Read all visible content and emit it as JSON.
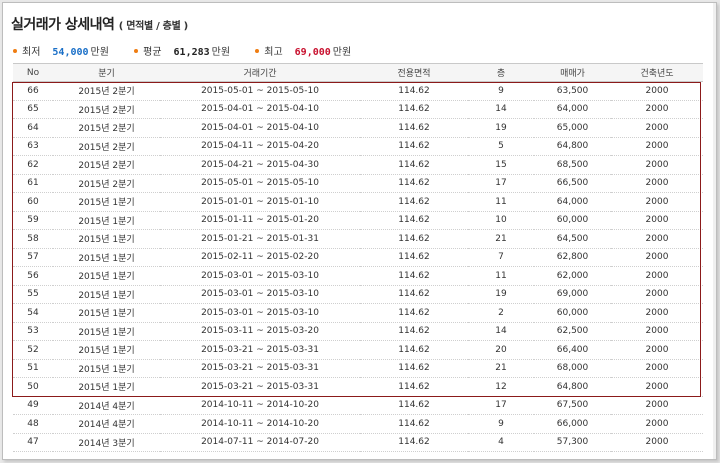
{
  "title": {
    "main": "실거래가 상세내역",
    "sub": "( 면적별 / 층별 )"
  },
  "summary": [
    {
      "label": "최저",
      "value": "54,000",
      "unit": "만원",
      "color": "#1a6fc7"
    },
    {
      "label": "평균",
      "value": "61,283",
      "unit": "만원",
      "color": "#222222"
    },
    {
      "label": "최고",
      "value": "69,000",
      "unit": "만원",
      "color": "#c8102e"
    }
  ],
  "colors": {
    "bullet": "#ef7d12",
    "highlight_border": "#8b1a1a",
    "min": "#1a6fc7",
    "max": "#c8102e"
  },
  "table": {
    "headers": [
      "No",
      "분기",
      "거래기간",
      "전용면적",
      "층",
      "매매가",
      "건축년도"
    ],
    "rows": [
      [
        "66",
        "2015년 2분기",
        "2015-05-01 ~ 2015-05-10",
        "114.62",
        "9",
        "63,500",
        "2000"
      ],
      [
        "65",
        "2015년 2분기",
        "2015-04-01 ~ 2015-04-10",
        "114.62",
        "14",
        "64,000",
        "2000"
      ],
      [
        "64",
        "2015년 2분기",
        "2015-04-01 ~ 2015-04-10",
        "114.62",
        "19",
        "65,000",
        "2000"
      ],
      [
        "63",
        "2015년 2분기",
        "2015-04-11 ~ 2015-04-20",
        "114.62",
        "5",
        "64,800",
        "2000"
      ],
      [
        "62",
        "2015년 2분기",
        "2015-04-21 ~ 2015-04-30",
        "114.62",
        "15",
        "68,500",
        "2000"
      ],
      [
        "61",
        "2015년 2분기",
        "2015-05-01 ~ 2015-05-10",
        "114.62",
        "17",
        "66,500",
        "2000"
      ],
      [
        "60",
        "2015년 1분기",
        "2015-01-01 ~ 2015-01-10",
        "114.62",
        "11",
        "64,000",
        "2000"
      ],
      [
        "59",
        "2015년 1분기",
        "2015-01-11 ~ 2015-01-20",
        "114.62",
        "10",
        "60,000",
        "2000"
      ],
      [
        "58",
        "2015년 1분기",
        "2015-01-21 ~ 2015-01-31",
        "114.62",
        "21",
        "64,500",
        "2000"
      ],
      [
        "57",
        "2015년 1분기",
        "2015-02-11 ~ 2015-02-20",
        "114.62",
        "7",
        "62,800",
        "2000"
      ],
      [
        "56",
        "2015년 1분기",
        "2015-03-01 ~ 2015-03-10",
        "114.62",
        "11",
        "62,000",
        "2000"
      ],
      [
        "55",
        "2015년 1분기",
        "2015-03-01 ~ 2015-03-10",
        "114.62",
        "19",
        "69,000",
        "2000"
      ],
      [
        "54",
        "2015년 1분기",
        "2015-03-01 ~ 2015-03-10",
        "114.62",
        "2",
        "60,000",
        "2000"
      ],
      [
        "53",
        "2015년 1분기",
        "2015-03-11 ~ 2015-03-20",
        "114.62",
        "14",
        "62,500",
        "2000"
      ],
      [
        "52",
        "2015년 1분기",
        "2015-03-21 ~ 2015-03-31",
        "114.62",
        "20",
        "66,400",
        "2000"
      ],
      [
        "51",
        "2015년 1분기",
        "2015-03-21 ~ 2015-03-31",
        "114.62",
        "21",
        "68,000",
        "2000"
      ],
      [
        "50",
        "2015년 1분기",
        "2015-03-21 ~ 2015-03-31",
        "114.62",
        "12",
        "64,800",
        "2000"
      ],
      [
        "49",
        "2014년 4분기",
        "2014-10-11 ~ 2014-10-20",
        "114.62",
        "17",
        "67,500",
        "2000"
      ],
      [
        "48",
        "2014년 4분기",
        "2014-10-11 ~ 2014-10-20",
        "114.62",
        "9",
        "66,000",
        "2000"
      ],
      [
        "47",
        "2014년 3분기",
        "2014-07-11 ~ 2014-07-20",
        "114.62",
        "4",
        "57,300",
        "2000"
      ]
    ]
  }
}
